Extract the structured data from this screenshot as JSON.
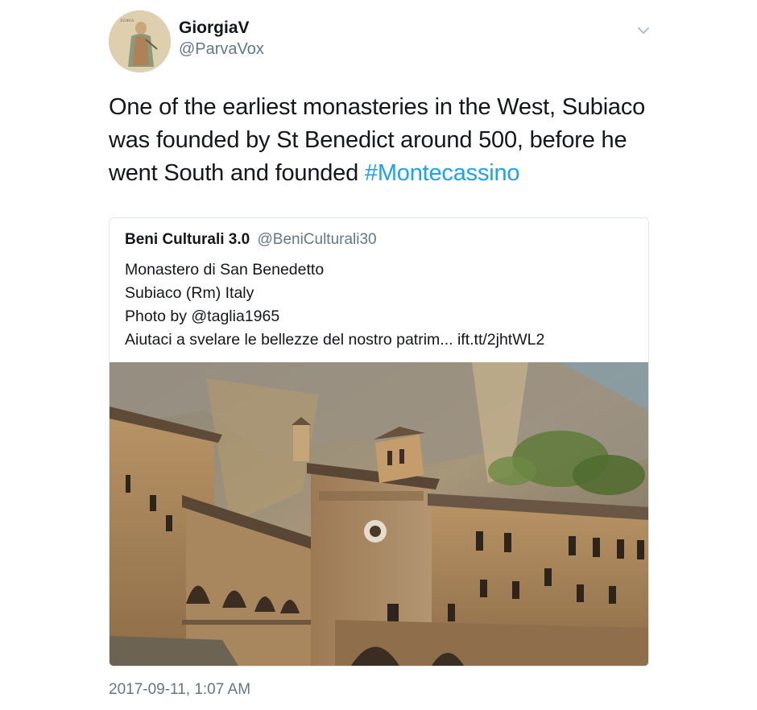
{
  "author": {
    "display_name": "GiorgiaV",
    "handle": "@ParvaVox",
    "avatar_icon": "fresco-figure-avatar"
  },
  "menu_icon": "chevron-down-icon",
  "tweet": {
    "text_before": "One of the earliest monasteries in the West, Subiaco was founded by St Benedict around 500, before he went South and founded ",
    "hashtag": "#Montecassino"
  },
  "quoted_tweet": {
    "display_name": "Beni Culturali 3.0",
    "handle": "@BeniCulturali30",
    "lines": [
      "Monastero di San Benedetto",
      "Subiaco (Rm) Italy",
      "Photo by @taglia1965",
      "Aiutaci a svelare le bellezze del nostro patrim... ift.tt/2jhtWL2"
    ],
    "photo_subject": "stone-monastery-under-cliff"
  },
  "timestamp": "2017-09-11, 1:07 AM",
  "colors": {
    "link": "#1da1f2",
    "secondary_text": "#657786",
    "primary_text": "#14171a",
    "border": "#e1e8ed"
  }
}
